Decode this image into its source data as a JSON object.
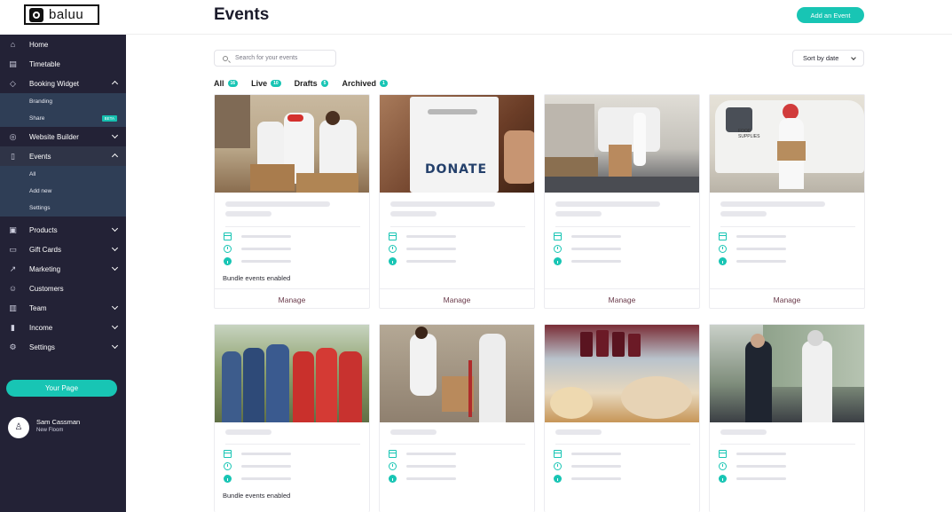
{
  "brand": {
    "name": "baluu"
  },
  "sidebar": {
    "items": [
      {
        "label": "Home",
        "icon": "home-icon"
      },
      {
        "label": "Timetable",
        "icon": "calendar-icon"
      },
      {
        "label": "Booking Widget",
        "icon": "tag-icon"
      },
      {
        "label": "Website Builder",
        "icon": "globe-icon"
      },
      {
        "label": "Events",
        "icon": "document-icon"
      },
      {
        "label": "Products",
        "icon": "box-icon"
      },
      {
        "label": "Gift Cards",
        "icon": "gift-icon"
      },
      {
        "label": "Marketing",
        "icon": "trend-icon"
      },
      {
        "label": "Customers",
        "icon": "users-icon"
      },
      {
        "label": "Team",
        "icon": "id-card-icon"
      },
      {
        "label": "Income",
        "icon": "bars-icon"
      },
      {
        "label": "Settings",
        "icon": "gear-icon"
      }
    ],
    "booking_sub": [
      {
        "label": "Branding"
      },
      {
        "label": "Share",
        "badge": "BETA"
      }
    ],
    "events_sub": [
      {
        "label": "All"
      },
      {
        "label": "Add new"
      },
      {
        "label": "Settings"
      }
    ],
    "your_page": "Your Page",
    "user": {
      "name": "Sam Cassman",
      "venue": "New Floom"
    }
  },
  "header": {
    "title": "Events",
    "add_button": "Add an Event",
    "search_placeholder": "Search for your events",
    "sort_label": "Sort by date"
  },
  "tabs": [
    {
      "label": "All",
      "count": "16"
    },
    {
      "label": "Live",
      "count": "10"
    },
    {
      "label": "Drafts",
      "count": "5"
    },
    {
      "label": "Archived",
      "count": "1"
    }
  ],
  "cards": [
    {
      "bundle": "Bundle events enabled",
      "manage": "Manage"
    },
    {
      "bundle": "",
      "manage": "Manage",
      "sign": "DONATE"
    },
    {
      "bundle": "",
      "manage": "Manage"
    },
    {
      "bundle": "",
      "manage": "Manage",
      "sign": "FOOD SUPPLIES"
    },
    {
      "bundle": "Bundle events enabled",
      "manage": ""
    },
    {
      "bundle": "",
      "manage": ""
    },
    {
      "bundle": "",
      "manage": ""
    },
    {
      "bundle": "",
      "manage": ""
    }
  ],
  "colors": {
    "accent": "#18c5b4",
    "sidebar": "#232236",
    "manage_text": "#6a3a4a"
  }
}
